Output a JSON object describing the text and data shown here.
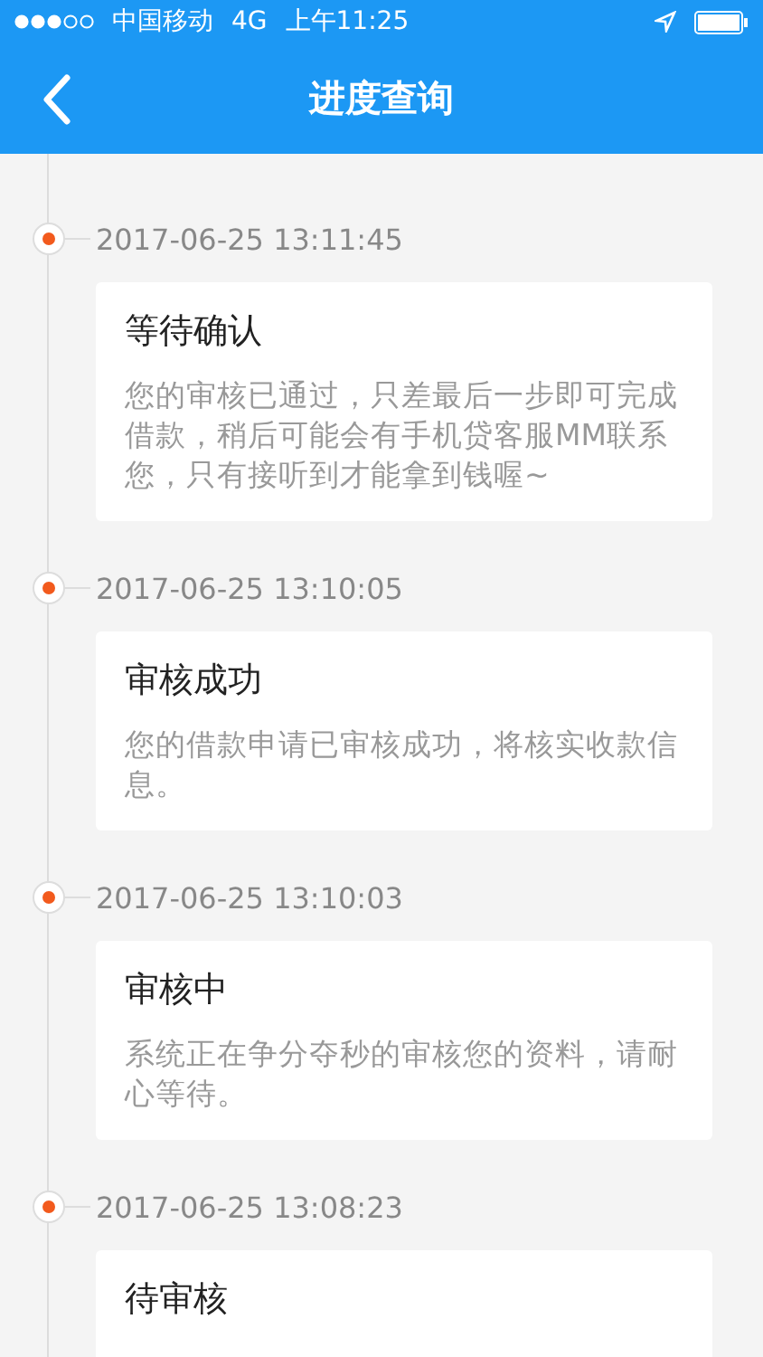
{
  "status_bar": {
    "carrier": "中国移动",
    "network": "4G",
    "time": "上午11:25"
  },
  "nav": {
    "title": "进度查询"
  },
  "timeline": [
    {
      "time": "2017-06-25 13:11:45",
      "title": "等待确认",
      "body": "您的审核已通过，只差最后一步即可完成借款，稍后可能会有手机贷客服MM联系您，只有接听到才能拿到钱喔~"
    },
    {
      "time": "2017-06-25 13:10:05",
      "title": "审核成功",
      "body": "您的借款申请已审核成功，将核实收款信息。"
    },
    {
      "time": "2017-06-25 13:10:03",
      "title": "审核中",
      "body": "系统正在争分夺秒的审核您的资料，请耐心等待。"
    },
    {
      "time": "2017-06-25 13:08:23",
      "title": "待审核"
    }
  ]
}
